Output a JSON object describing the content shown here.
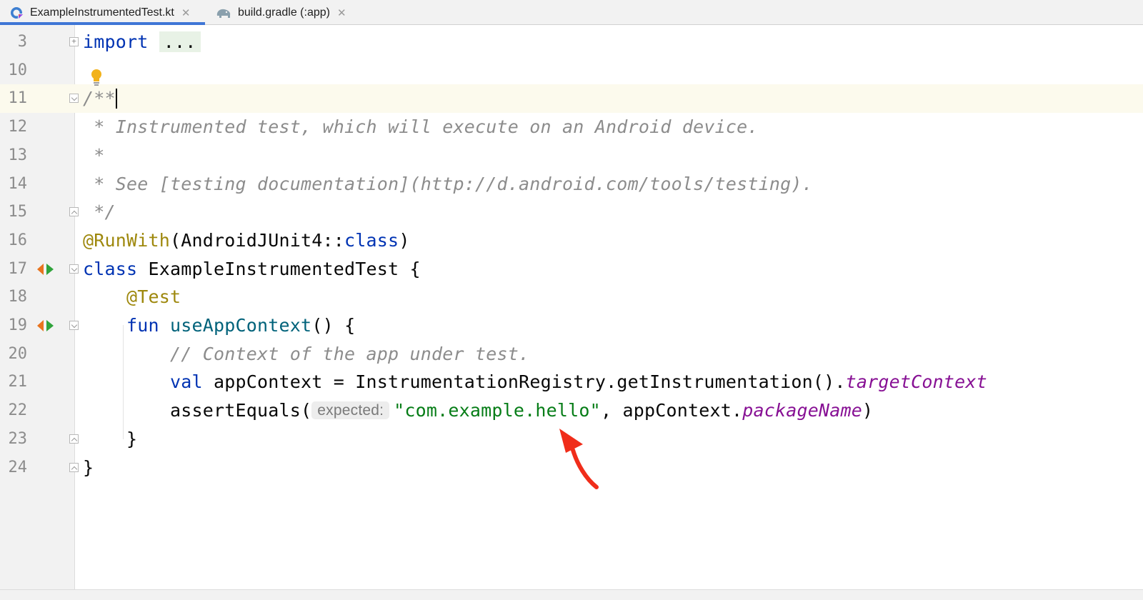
{
  "tabs": [
    {
      "label": "ExampleInstrumentedTest.kt",
      "icon": "kotlin-file-icon",
      "active": true
    },
    {
      "label": "build.gradle (:app)",
      "icon": "gradle-elephant-icon",
      "active": false
    }
  ],
  "tab_close_glyph": "✕",
  "colors": {
    "accent": "#3f76d6",
    "keyword": "#0033b3",
    "annotation": "#9e880d",
    "comment": "#8c8c8c",
    "string": "#067d17",
    "function": "#00627a",
    "property": "#871094",
    "arrow": "#f02d1a"
  },
  "editor": {
    "current_line": "11",
    "lines": [
      {
        "num": "3",
        "tokens": [
          {
            "t": "import",
            "c": "kw"
          },
          {
            "t": " "
          },
          {
            "t": "...",
            "c": "fold-text"
          }
        ]
      },
      {
        "num": "10",
        "tokens": []
      },
      {
        "num": "11",
        "tokens": [
          {
            "t": "/**",
            "c": "cmt"
          }
        ]
      },
      {
        "num": "12",
        "tokens": [
          {
            "t": " * Instrumented test, which will execute on an Android device.",
            "c": "cmt"
          }
        ]
      },
      {
        "num": "13",
        "tokens": [
          {
            "t": " *",
            "c": "cmt"
          }
        ]
      },
      {
        "num": "14",
        "tokens": [
          {
            "t": " * See [testing documentation](http://d.android.com/tools/testing).",
            "c": "cmt"
          }
        ]
      },
      {
        "num": "15",
        "tokens": [
          {
            "t": " */",
            "c": "cmt"
          }
        ]
      },
      {
        "num": "16",
        "tokens": [
          {
            "t": "@RunWith",
            "c": "ann"
          },
          {
            "t": "(AndroidJUnit4::"
          },
          {
            "t": "class",
            "c": "kw"
          },
          {
            "t": ")"
          }
        ]
      },
      {
        "num": "17",
        "tokens": [
          {
            "t": "class",
            "c": "kw"
          },
          {
            "t": " ExampleInstrumentedTest {"
          }
        ]
      },
      {
        "num": "18",
        "tokens": [
          {
            "t": "    "
          },
          {
            "t": "@Test",
            "c": "ann"
          }
        ]
      },
      {
        "num": "19",
        "tokens": [
          {
            "t": "    "
          },
          {
            "t": "fun",
            "c": "kw"
          },
          {
            "t": " "
          },
          {
            "t": "useAppContext",
            "c": "fn"
          },
          {
            "t": "() {"
          }
        ]
      },
      {
        "num": "20",
        "tokens": [
          {
            "t": "        "
          },
          {
            "t": "// Context of the app under test.",
            "c": "cmt"
          }
        ]
      },
      {
        "num": "21",
        "tokens": [
          {
            "t": "        "
          },
          {
            "t": "val",
            "c": "kw"
          },
          {
            "t": " appContext = InstrumentationRegistry.getInstrumentation()."
          },
          {
            "t": "targetContext",
            "c": "prop"
          }
        ]
      },
      {
        "num": "22",
        "tokens": [
          {
            "t": "        assertEquals("
          },
          {
            "t": "expected:",
            "c": "hint"
          },
          {
            "t": "\"com.example.hello\"",
            "c": "str"
          },
          {
            "t": ", appContext."
          },
          {
            "t": "packageName",
            "c": "prop"
          },
          {
            "t": ")"
          }
        ]
      },
      {
        "num": "23",
        "tokens": [
          {
            "t": "    }"
          }
        ]
      },
      {
        "num": "24",
        "tokens": [
          {
            "t": "}"
          }
        ]
      }
    ]
  },
  "gutter_markers": {
    "run_lines": [
      "17",
      "19"
    ],
    "fold_open_lines": [
      "11",
      "17",
      "19"
    ],
    "fold_close_lines": [
      "15",
      "23",
      "24"
    ],
    "fold_collapsed_lines": [
      "3"
    ],
    "intention_bulb_line": "10"
  }
}
